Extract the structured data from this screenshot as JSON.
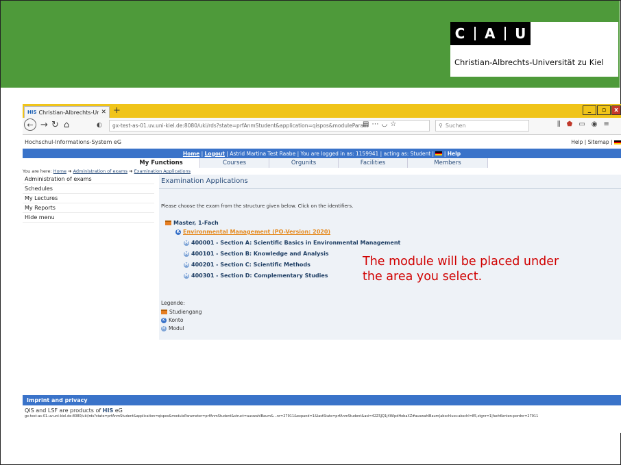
{
  "slide": {
    "logo_letters": [
      "C",
      "A",
      "U"
    ],
    "university_name": "Christian-Albrechts-Universität zu Kiel",
    "brand_green": "#4e9a3a"
  },
  "browser": {
    "tab_title": "Christian-Albrechts-Universität",
    "tab_icon": "HIS",
    "url": "gx-test-as-01.uv.uni-kiel.de:8080/uki/rds?state=prfAnmStudent&application=qispos&moduleParam",
    "search_placeholder": "Suchen",
    "window_controls": [
      "_",
      "▫",
      "x"
    ]
  },
  "page": {
    "org_name": "Hochschul-Informations-System eG",
    "help_links": "Help | Sitemap |",
    "topbar": {
      "home": "Home",
      "logout": "Logout",
      "logged_in_text": "Astrid Martina Test Raabe | You are logged in as:  1159941  |  acting as: Student |",
      "help": "Help"
    },
    "tabs": [
      "My Functions",
      "Courses",
      "Orgunits",
      "Facilities",
      "Members"
    ],
    "breadcrumb": {
      "prefix": "You are here:",
      "home": "Home",
      "admin": "Administration of exams",
      "current": "Examination Applications"
    },
    "menu": [
      "Administration of exams",
      "Schedules",
      "My Lectures",
      "My Reports",
      "Hide menu"
    ],
    "content": {
      "title": "Examination Applications",
      "instruction": "Please choose the exam from the structure given below. Click on the identifiers.",
      "degree": "Master, 1-Fach",
      "account": "Environmental Management (PO-Version: 2020)",
      "modules": [
        "400001 - Section A: Scientific Basics in Environmental Management",
        "400101 - Section B: Knowledge and Analysis",
        "400201 - Section C: Scientific Methods",
        "400301 - Section D: Complementary Studies"
      ],
      "legend_title": "Legende:",
      "legend": [
        "Studiengang",
        "Konto",
        "Modul"
      ]
    },
    "footer": {
      "bar": "Imprint and privacy",
      "products_prefix": "QIS and LSF are products of ",
      "products_brand": "HIS",
      "products_suffix": " eG",
      "status_url": "gx-test-as-01.uv.uni-kiel.de:8080/uki/rds?state=prfAnmStudent&application=qispos&moduleParameter=prfAnmStudent&struct=auswahlBaum&...nr=27911&expand=1&lastState=prfAnmStudent&asi=42ZSJQ1j4WlpdHobaXZ#auswahlBaum|abschluss:abschl=85,stgnr=1|fachKonten:pordnr=27911"
    }
  },
  "annotation": "The module will be placed under the area you select."
}
